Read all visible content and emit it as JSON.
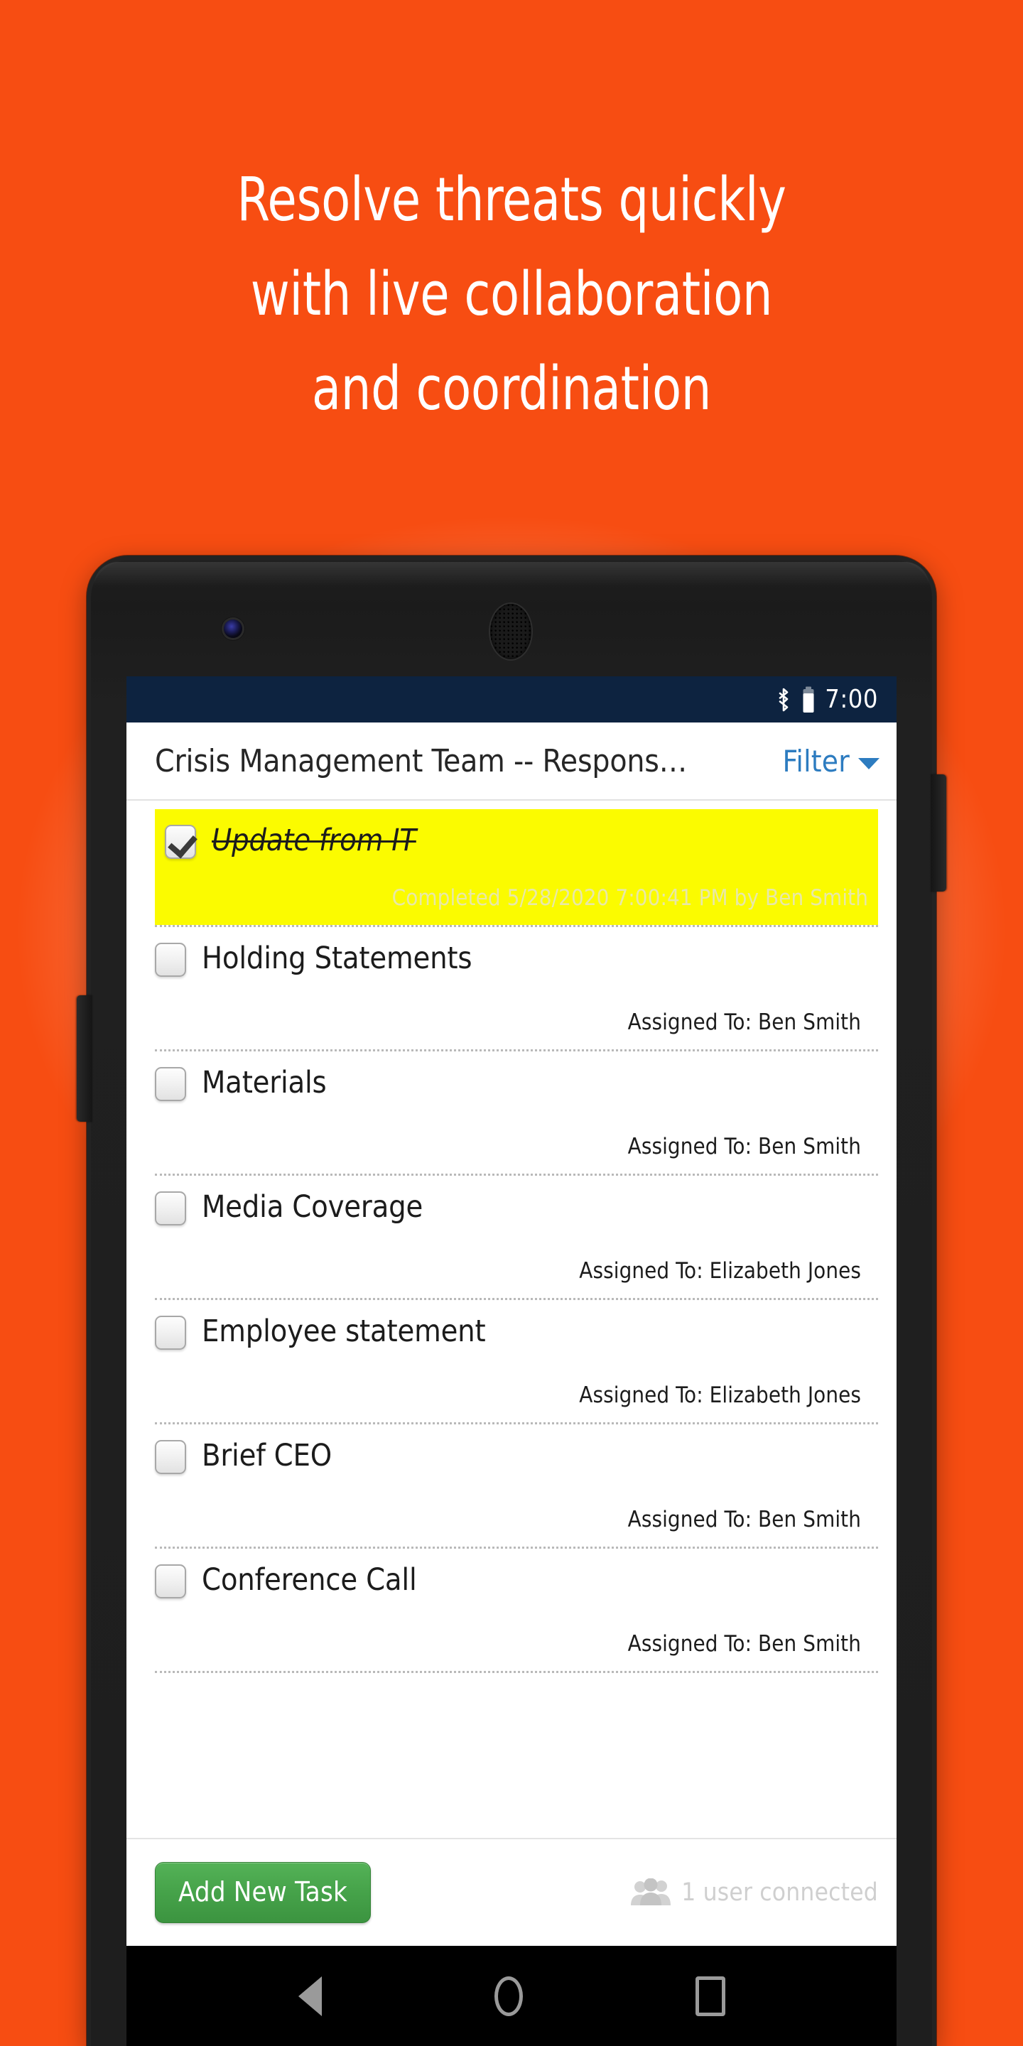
{
  "promo": {
    "headline": "Resolve threats quickly\nwith live collaboration\nand coordination",
    "background_top_color": "#f03c00",
    "background_bottom_color": "#22a9de"
  },
  "status_bar": {
    "time": "7:00",
    "icons": [
      "bluetooth-icon",
      "battery-icon"
    ],
    "background_color": "#0d2340"
  },
  "app_header": {
    "title": "Crisis Management Team -- Respons…",
    "filter_label": "Filter",
    "filter_color": "#2d7cc0"
  },
  "tasks": [
    {
      "label": "Update from IT",
      "checked": true,
      "highlighted": true,
      "highlight_color": "#fbfb00",
      "meta": "Completed 5/28/2020 7:00:41 PM by Ben Smith"
    },
    {
      "label": "Holding Statements",
      "checked": false,
      "highlighted": false,
      "meta": "Assigned To: Ben Smith"
    },
    {
      "label": "Materials",
      "checked": false,
      "highlighted": false,
      "meta": "Assigned To: Ben Smith"
    },
    {
      "label": "Media Coverage",
      "checked": false,
      "highlighted": false,
      "meta": "Assigned To: Elizabeth Jones"
    },
    {
      "label": "Employee statement",
      "checked": false,
      "highlighted": false,
      "meta": "Assigned To: Elizabeth Jones"
    },
    {
      "label": "Brief CEO",
      "checked": false,
      "highlighted": false,
      "meta": "Assigned To: Ben Smith"
    },
    {
      "label": "Conference Call",
      "checked": false,
      "highlighted": false,
      "meta": "Assigned To: Ben Smith"
    }
  ],
  "footer": {
    "add_task_label": "Add New Task",
    "add_task_color": "#46a34a",
    "connected_label": "1 user connected",
    "connected_icon": "users-group-icon"
  },
  "nav_bar": {
    "items": [
      "back-button",
      "home-button",
      "recents-button"
    ]
  },
  "device": {
    "hardware": [
      "front-camera",
      "earpiece-speaker",
      "volume-button",
      "power-button"
    ]
  }
}
